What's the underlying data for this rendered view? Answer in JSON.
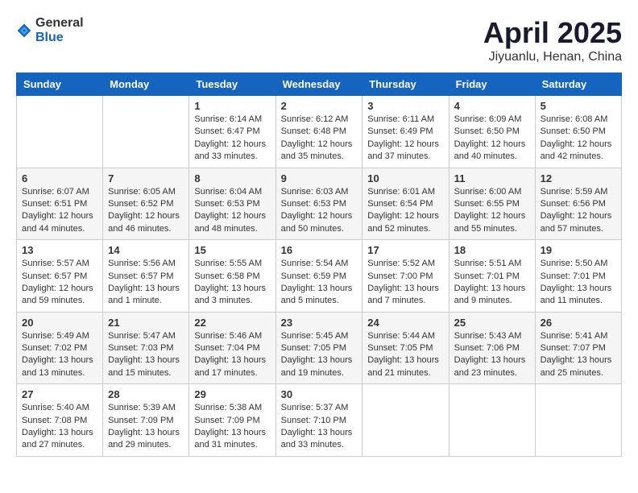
{
  "header": {
    "logo_general": "General",
    "logo_blue": "Blue",
    "month_title": "April 2025",
    "location": "Jiyuanlu, Henan, China"
  },
  "weekdays": [
    "Sunday",
    "Monday",
    "Tuesday",
    "Wednesday",
    "Thursday",
    "Friday",
    "Saturday"
  ],
  "weeks": [
    [
      {
        "day": "",
        "info": ""
      },
      {
        "day": "",
        "info": ""
      },
      {
        "day": "1",
        "sunrise": "Sunrise: 6:14 AM",
        "sunset": "Sunset: 6:47 PM",
        "daylight": "Daylight: 12 hours and 33 minutes."
      },
      {
        "day": "2",
        "sunrise": "Sunrise: 6:12 AM",
        "sunset": "Sunset: 6:48 PM",
        "daylight": "Daylight: 12 hours and 35 minutes."
      },
      {
        "day": "3",
        "sunrise": "Sunrise: 6:11 AM",
        "sunset": "Sunset: 6:49 PM",
        "daylight": "Daylight: 12 hours and 37 minutes."
      },
      {
        "day": "4",
        "sunrise": "Sunrise: 6:09 AM",
        "sunset": "Sunset: 6:50 PM",
        "daylight": "Daylight: 12 hours and 40 minutes."
      },
      {
        "day": "5",
        "sunrise": "Sunrise: 6:08 AM",
        "sunset": "Sunset: 6:50 PM",
        "daylight": "Daylight: 12 hours and 42 minutes."
      }
    ],
    [
      {
        "day": "6",
        "sunrise": "Sunrise: 6:07 AM",
        "sunset": "Sunset: 6:51 PM",
        "daylight": "Daylight: 12 hours and 44 minutes."
      },
      {
        "day": "7",
        "sunrise": "Sunrise: 6:05 AM",
        "sunset": "Sunset: 6:52 PM",
        "daylight": "Daylight: 12 hours and 46 minutes."
      },
      {
        "day": "8",
        "sunrise": "Sunrise: 6:04 AM",
        "sunset": "Sunset: 6:53 PM",
        "daylight": "Daylight: 12 hours and 48 minutes."
      },
      {
        "day": "9",
        "sunrise": "Sunrise: 6:03 AM",
        "sunset": "Sunset: 6:53 PM",
        "daylight": "Daylight: 12 hours and 50 minutes."
      },
      {
        "day": "10",
        "sunrise": "Sunrise: 6:01 AM",
        "sunset": "Sunset: 6:54 PM",
        "daylight": "Daylight: 12 hours and 52 minutes."
      },
      {
        "day": "11",
        "sunrise": "Sunrise: 6:00 AM",
        "sunset": "Sunset: 6:55 PM",
        "daylight": "Daylight: 12 hours and 55 minutes."
      },
      {
        "day": "12",
        "sunrise": "Sunrise: 5:59 AM",
        "sunset": "Sunset: 6:56 PM",
        "daylight": "Daylight: 12 hours and 57 minutes."
      }
    ],
    [
      {
        "day": "13",
        "sunrise": "Sunrise: 5:57 AM",
        "sunset": "Sunset: 6:57 PM",
        "daylight": "Daylight: 12 hours and 59 minutes."
      },
      {
        "day": "14",
        "sunrise": "Sunrise: 5:56 AM",
        "sunset": "Sunset: 6:57 PM",
        "daylight": "Daylight: 13 hours and 1 minute."
      },
      {
        "day": "15",
        "sunrise": "Sunrise: 5:55 AM",
        "sunset": "Sunset: 6:58 PM",
        "daylight": "Daylight: 13 hours and 3 minutes."
      },
      {
        "day": "16",
        "sunrise": "Sunrise: 5:54 AM",
        "sunset": "Sunset: 6:59 PM",
        "daylight": "Daylight: 13 hours and 5 minutes."
      },
      {
        "day": "17",
        "sunrise": "Sunrise: 5:52 AM",
        "sunset": "Sunset: 7:00 PM",
        "daylight": "Daylight: 13 hours and 7 minutes."
      },
      {
        "day": "18",
        "sunrise": "Sunrise: 5:51 AM",
        "sunset": "Sunset: 7:01 PM",
        "daylight": "Daylight: 13 hours and 9 minutes."
      },
      {
        "day": "19",
        "sunrise": "Sunrise: 5:50 AM",
        "sunset": "Sunset: 7:01 PM",
        "daylight": "Daylight: 13 hours and 11 minutes."
      }
    ],
    [
      {
        "day": "20",
        "sunrise": "Sunrise: 5:49 AM",
        "sunset": "Sunset: 7:02 PM",
        "daylight": "Daylight: 13 hours and 13 minutes."
      },
      {
        "day": "21",
        "sunrise": "Sunrise: 5:47 AM",
        "sunset": "Sunset: 7:03 PM",
        "daylight": "Daylight: 13 hours and 15 minutes."
      },
      {
        "day": "22",
        "sunrise": "Sunrise: 5:46 AM",
        "sunset": "Sunset: 7:04 PM",
        "daylight": "Daylight: 13 hours and 17 minutes."
      },
      {
        "day": "23",
        "sunrise": "Sunrise: 5:45 AM",
        "sunset": "Sunset: 7:05 PM",
        "daylight": "Daylight: 13 hours and 19 minutes."
      },
      {
        "day": "24",
        "sunrise": "Sunrise: 5:44 AM",
        "sunset": "Sunset: 7:05 PM",
        "daylight": "Daylight: 13 hours and 21 minutes."
      },
      {
        "day": "25",
        "sunrise": "Sunrise: 5:43 AM",
        "sunset": "Sunset: 7:06 PM",
        "daylight": "Daylight: 13 hours and 23 minutes."
      },
      {
        "day": "26",
        "sunrise": "Sunrise: 5:41 AM",
        "sunset": "Sunset: 7:07 PM",
        "daylight": "Daylight: 13 hours and 25 minutes."
      }
    ],
    [
      {
        "day": "27",
        "sunrise": "Sunrise: 5:40 AM",
        "sunset": "Sunset: 7:08 PM",
        "daylight": "Daylight: 13 hours and 27 minutes."
      },
      {
        "day": "28",
        "sunrise": "Sunrise: 5:39 AM",
        "sunset": "Sunset: 7:09 PM",
        "daylight": "Daylight: 13 hours and 29 minutes."
      },
      {
        "day": "29",
        "sunrise": "Sunrise: 5:38 AM",
        "sunset": "Sunset: 7:09 PM",
        "daylight": "Daylight: 13 hours and 31 minutes."
      },
      {
        "day": "30",
        "sunrise": "Sunrise: 5:37 AM",
        "sunset": "Sunset: 7:10 PM",
        "daylight": "Daylight: 13 hours and 33 minutes."
      },
      {
        "day": "",
        "info": ""
      },
      {
        "day": "",
        "info": ""
      },
      {
        "day": "",
        "info": ""
      }
    ]
  ]
}
